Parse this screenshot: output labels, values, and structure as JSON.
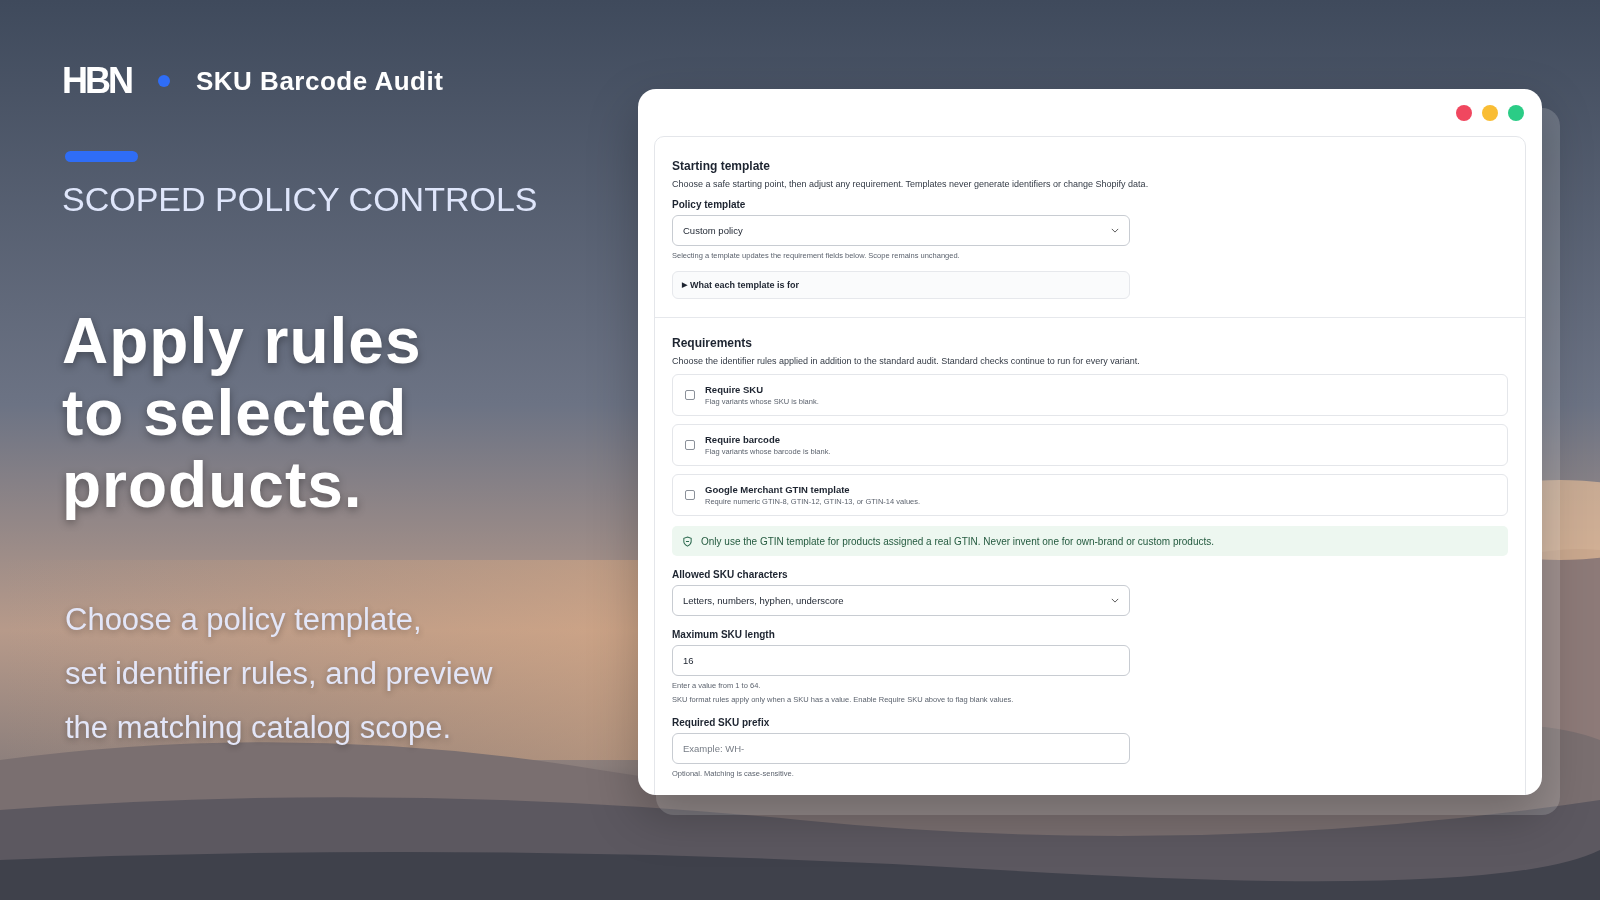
{
  "brand": {
    "logo": "HBN",
    "product": "SKU Barcode Audit"
  },
  "eyebrow": "SCOPED POLICY CONTROLS",
  "headline": [
    "Apply rules",
    "to selected",
    "products."
  ],
  "subtext": [
    "Choose a policy template,",
    "set identifier rules, and preview",
    "the matching catalog scope."
  ],
  "window": {
    "starting_template": {
      "title": "Starting template",
      "description": "Choose a safe starting point, then adjust any requirement. Templates never generate identifiers or change Shopify data.",
      "field_label": "Policy template",
      "value": "Custom policy",
      "help": "Selecting a template updates the requirement fields below. Scope remains unchanged.",
      "disclosure": {
        "marker": "▶",
        "label": "What each template is for",
        "expanded": false
      }
    },
    "requirements": {
      "title": "Requirements",
      "description": "Choose the identifier rules applied in addition to the standard audit. Standard checks continue to run for every variant.",
      "options": [
        {
          "label": "Require SKU",
          "hint": "Flag variants whose SKU is blank.",
          "checked": false
        },
        {
          "label": "Require barcode",
          "hint": "Flag variants whose barcode is blank.",
          "checked": false
        },
        {
          "label": "Google Merchant GTIN template",
          "hint": "Require numeric GTIN-8, GTIN-12, GTIN-13, or GTIN-14 values.",
          "checked": false
        }
      ],
      "notice": "Only use the GTIN template for products assigned a real GTIN. Never invent one for own-brand or custom products.",
      "fields": [
        {
          "kind": "select",
          "label": "Allowed SKU characters",
          "value": "Letters, numbers, hyphen, underscore"
        },
        {
          "kind": "input",
          "label": "Maximum SKU length",
          "value": "16",
          "help": [
            "Enter a value from 1 to 64.",
            "SKU format rules apply only when a SKU has a value. Enable Require SKU above to flag blank values."
          ]
        },
        {
          "kind": "input",
          "label": "Required SKU prefix",
          "placeholder": "Example: WH-",
          "help": [
            "Optional. Matching is case-sensitive."
          ]
        }
      ]
    }
  }
}
